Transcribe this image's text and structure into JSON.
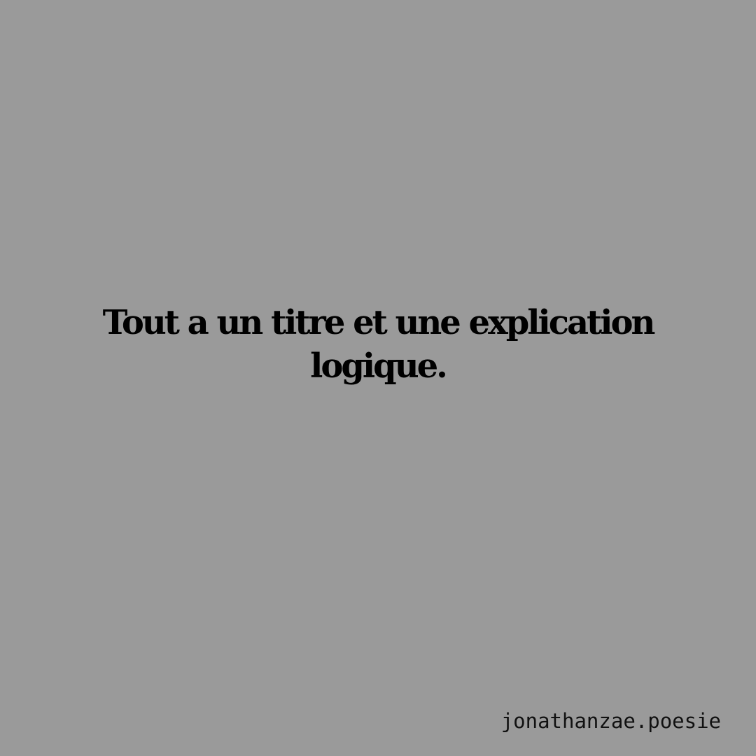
{
  "quote": {
    "lines": [
      "Tout a un titre et une explication",
      "logique."
    ]
  },
  "signature": {
    "handle": "jonathanzae.poesie"
  },
  "colors": {
    "background": "#9a9a9a",
    "text": "#000000"
  }
}
